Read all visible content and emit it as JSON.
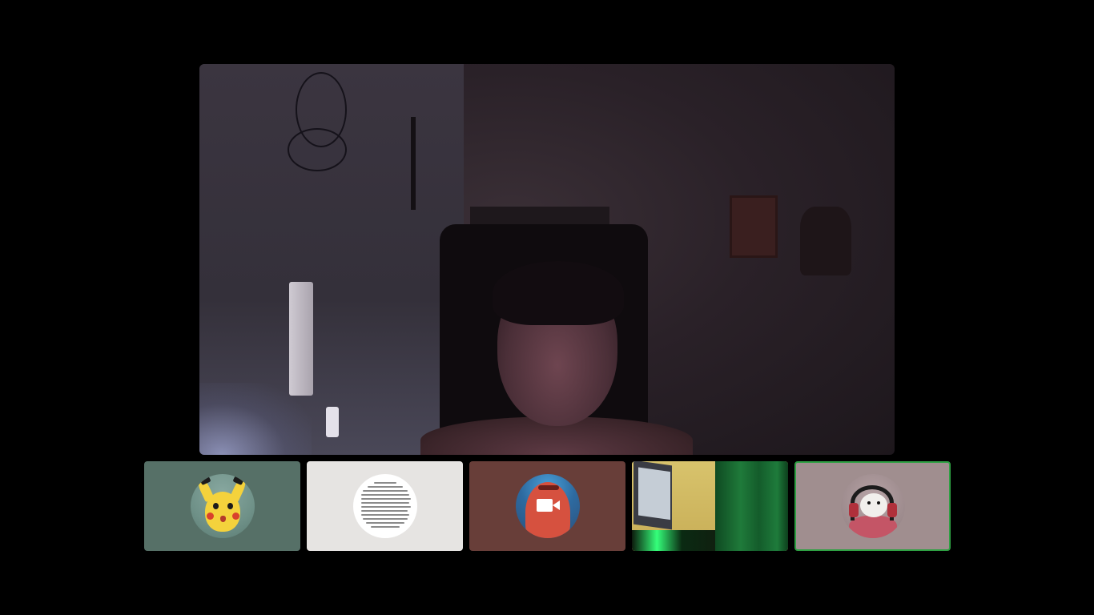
{
  "meeting": {
    "layout": "speaker-view",
    "active_speaker_border_color": "#2ea043"
  },
  "main_video": {
    "subject": "active-speaker-camera-feed"
  },
  "participants": [
    {
      "tile": "participant-1",
      "avatar": "pikachu-avatar",
      "background": "#567067",
      "camera": "off"
    },
    {
      "tile": "participant-2",
      "avatar": "document-avatar",
      "background": "#e6e4e2",
      "camera": "off"
    },
    {
      "tile": "participant-3",
      "avatar": "patrick-avatar",
      "background": "#683e39",
      "camera": "off",
      "icon": "video-camera-icon"
    },
    {
      "tile": "participant-4",
      "avatar": "camera-feed",
      "background": "#d9bf6a",
      "camera": "on"
    },
    {
      "tile": "participant-5",
      "avatar": "dog-headphones-avatar",
      "background": "#a08e8f",
      "camera": "off",
      "active": true
    }
  ]
}
